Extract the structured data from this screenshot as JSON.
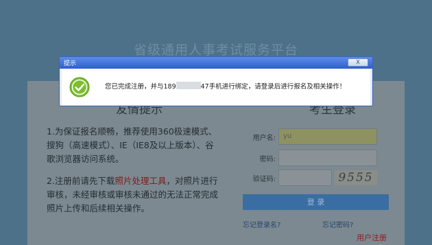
{
  "site": {
    "title": "省级通用人事考试服务平台"
  },
  "notice": {
    "heading": "友情提示",
    "para1": "1.为保证报名顺畅，推荐使用360极速模式、搜狗（高速模式）、IE（IE8及以上版本）、谷歌浏览器访问系统。",
    "para2_prefix": "2.注册前请先下载",
    "para2_link": "照片处理工具",
    "para2_suffix": "，对照片进行审核，未经审核或审核未通过的无法正常完成照片上传和后续相关操作。"
  },
  "login": {
    "heading": "考生登录",
    "username_label": "用户名:",
    "username_value": "yu",
    "password_label": "密码:",
    "captcha_label": "验证码:",
    "captcha_text": "9555",
    "login_button": "登 录",
    "forgot_username": "忘记登录名?",
    "forgot_password": "忘记密码?",
    "register": "用户注册"
  },
  "dialog": {
    "title": "提示",
    "close_label": "X",
    "message_prefix": "您已完成注册，并与189",
    "message_suffix": "47手机进行绑定，请登录后进行报名及相关操作！",
    "icon": "check-circle-icon",
    "icon_color": "#7cbf2a"
  }
}
